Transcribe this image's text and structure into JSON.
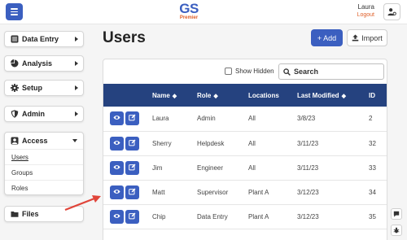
{
  "header": {
    "logo_main": "GS",
    "logo_sub": "Premier",
    "user_name": "Laura",
    "logout_label": "Logout"
  },
  "sidebar": {
    "items": [
      {
        "label": "Data Entry",
        "icon": "list-icon"
      },
      {
        "label": "Analysis",
        "icon": "pie-chart-icon"
      },
      {
        "label": "Setup",
        "icon": "gear-icon"
      },
      {
        "label": "Admin",
        "icon": "shield-icon"
      }
    ],
    "access": {
      "label": "Access",
      "icon": "user-icon",
      "sub_items": [
        "Users",
        "Groups",
        "Roles"
      ],
      "active": "Users"
    },
    "files": {
      "label": "Files",
      "icon": "folder-icon"
    }
  },
  "main": {
    "title": "Users",
    "add_label": "+ Add",
    "import_label": "Import",
    "show_hidden_label": "Show Hidden",
    "search_placeholder": "Search"
  },
  "table": {
    "columns": [
      "Name",
      "Role",
      "Locations",
      "Last Modified",
      "ID"
    ],
    "rows": [
      {
        "name": "Laura",
        "role": "Admin",
        "locations": "All",
        "modified": "3/8/23",
        "id": "2"
      },
      {
        "name": "Sherry",
        "role": "Helpdesk",
        "locations": "All",
        "modified": "3/11/23",
        "id": "32"
      },
      {
        "name": "Jim",
        "role": "Engineer",
        "locations": "All",
        "modified": "3/11/23",
        "id": "33"
      },
      {
        "name": "Matt",
        "role": "Supervisor",
        "locations": "Plant A",
        "modified": "3/12/23",
        "id": "34"
      },
      {
        "name": "Chip",
        "role": "Data Entry",
        "locations": "Plant A",
        "modified": "3/12/23",
        "id": "35"
      }
    ]
  },
  "colors": {
    "accent": "#3b5fc0",
    "table_header": "#25427f",
    "logo_sub": "#e0602a",
    "annotation_arrow": "#e0453a"
  }
}
